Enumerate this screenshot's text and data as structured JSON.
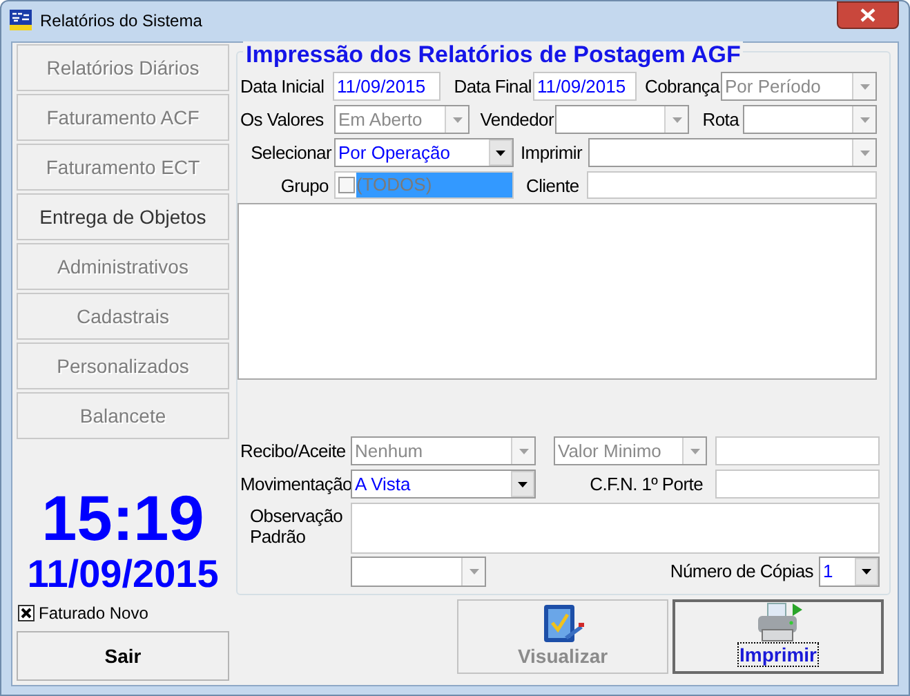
{
  "window": {
    "title": "Relatórios do Sistema"
  },
  "sidebar": {
    "buttons": [
      {
        "label": "Relatórios Diários",
        "disabled": true
      },
      {
        "label": "Faturamento ACF",
        "disabled": true
      },
      {
        "label": "Faturamento ECT",
        "disabled": true
      },
      {
        "label": "Entrega de Objetos",
        "disabled": false
      },
      {
        "label": "Administrativos",
        "disabled": true
      },
      {
        "label": "Cadastrais",
        "disabled": true
      },
      {
        "label": "Personalizados",
        "disabled": true
      },
      {
        "label": "Balancete",
        "disabled": true
      }
    ],
    "clock": {
      "time": "15:19",
      "date": "11/09/2015"
    },
    "faturado_novo": {
      "label": "Faturado Novo",
      "checked": true
    },
    "exit_button": {
      "label": "Sair"
    }
  },
  "form": {
    "title": "Impressão dos Relatórios de Postagem AGF",
    "fields": {
      "data_inicial": {
        "label": "Data Inicial",
        "kind": "text",
        "value": "11/09/2015"
      },
      "data_final": {
        "label": "Data Final",
        "kind": "text",
        "value": "11/09/2015"
      },
      "cobranca": {
        "label": "Cobrança",
        "kind": "combo",
        "value": "Por Período",
        "disabled": true
      },
      "os_valores": {
        "label": "Os Valores",
        "kind": "combo",
        "value": "Em Aberto",
        "disabled": true
      },
      "vendedor": {
        "label": "Vendedor",
        "kind": "combo",
        "disabled": true
      },
      "rota": {
        "label": "Rota",
        "kind": "combo",
        "disabled": true
      },
      "selecionar": {
        "label": "Selecionar",
        "kind": "combo",
        "value": "Por Operação",
        "disabled": false
      },
      "imprimir": {
        "label": "Imprimir",
        "kind": "combo",
        "disabled": true
      },
      "grupo": {
        "label": "Grupo",
        "kind": "checklist",
        "value": "(TODOS)",
        "checked": false,
        "selected": true,
        "disabled": true
      },
      "cliente": {
        "label": "Cliente",
        "kind": "text"
      },
      "list_box": {
        "kind": "listbox"
      },
      "recibo_aceite": {
        "label": "Recibo/Aceite",
        "kind": "combo",
        "value": "Nenhum",
        "disabled": true
      },
      "valor_minimo": {
        "kind": "combo",
        "value": "Valor Minimo",
        "disabled": true
      },
      "field_after_valor_minimo": {
        "kind": "text"
      },
      "movimentacao": {
        "label": "Movimentação",
        "kind": "combo",
        "value": "A Vista",
        "disabled": false
      },
      "cfn_1o_porte": {
        "label": "C.F.N. 1º Porte",
        "kind": "text"
      },
      "observacao_padrao": {
        "label": "Observação Padrão",
        "kind": "textarea"
      },
      "combo_below_observacao": {
        "kind": "combo",
        "disabled": true
      },
      "numero_de_copias": {
        "label": "Número de Cópias",
        "kind": "combo",
        "value": "1",
        "disabled": false
      }
    }
  },
  "actions": [
    {
      "label": "Visualizar",
      "disabled": true,
      "focused": false,
      "kind": "preview"
    },
    {
      "label": "Imprimir",
      "disabled": false,
      "focused": true,
      "kind": "printer"
    }
  ]
}
